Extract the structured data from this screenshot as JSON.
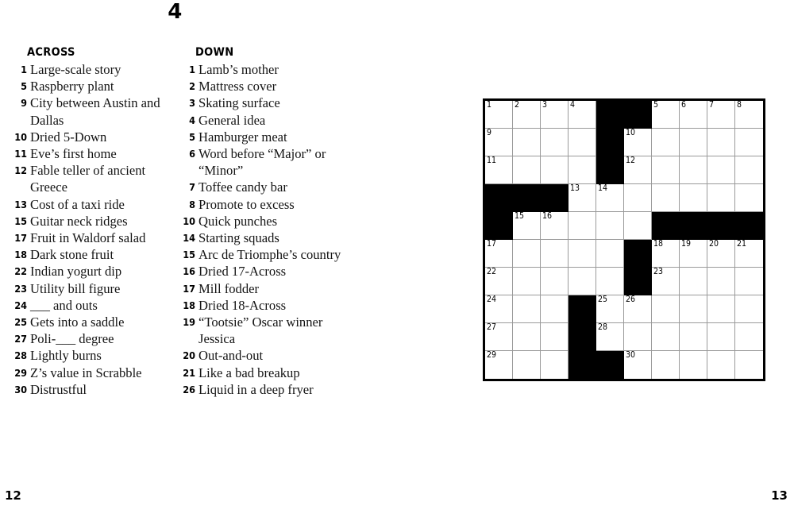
{
  "puzzle": {
    "number": "4"
  },
  "across": {
    "heading": "ACROSS",
    "clues": [
      {
        "num": "1",
        "text": "Large-scale story"
      },
      {
        "num": "5",
        "text": "Raspberry plant"
      },
      {
        "num": "9",
        "text": "City between Austin and Dallas"
      },
      {
        "num": "10",
        "text": "Dried 5-Down"
      },
      {
        "num": "11",
        "text": "Eve’s first home"
      },
      {
        "num": "12",
        "text": "Fable teller of ancient Greece"
      },
      {
        "num": "13",
        "text": "Cost of a taxi ride"
      },
      {
        "num": "15",
        "text": "Guitar neck ridges"
      },
      {
        "num": "17",
        "text": "Fruit in Waldorf salad"
      },
      {
        "num": "18",
        "text": "Dark stone fruit"
      },
      {
        "num": "22",
        "text": "Indian yogurt dip"
      },
      {
        "num": "23",
        "text": "Utility bill figure"
      },
      {
        "num": "24",
        "text": "___ and outs"
      },
      {
        "num": "25",
        "text": "Gets into a saddle"
      },
      {
        "num": "27",
        "text": "Poli-___ degree"
      },
      {
        "num": "28",
        "text": "Lightly burns"
      },
      {
        "num": "29",
        "text": "Z’s value in Scrabble"
      },
      {
        "num": "30",
        "text": "Distrustful"
      }
    ]
  },
  "down": {
    "heading": "DOWN",
    "clues": [
      {
        "num": "1",
        "text": "Lamb’s mother"
      },
      {
        "num": "2",
        "text": "Mattress cover"
      },
      {
        "num": "3",
        "text": "Skating surface"
      },
      {
        "num": "4",
        "text": "General idea"
      },
      {
        "num": "5",
        "text": "Hamburger meat"
      },
      {
        "num": "6",
        "text": "Word before “Major” or “Minor”"
      },
      {
        "num": "7",
        "text": "Toffee candy bar"
      },
      {
        "num": "8",
        "text": "Promote to excess"
      },
      {
        "num": "10",
        "text": "Quick punches"
      },
      {
        "num": "14",
        "text": "Starting squads"
      },
      {
        "num": "15",
        "text": "Arc de Triomphe’s country"
      },
      {
        "num": "16",
        "text": "Dried 17-Across"
      },
      {
        "num": "17",
        "text": "Mill fodder"
      },
      {
        "num": "18",
        "text": "Dried 18-Across"
      },
      {
        "num": "19",
        "text": "“Tootsie” Oscar winner Jessica"
      },
      {
        "num": "20",
        "text": "Out-and-out"
      },
      {
        "num": "21",
        "text": "Like a bad breakup"
      },
      {
        "num": "26",
        "text": "Liquid in a deep fryer"
      }
    ]
  },
  "grid": {
    "rows": 10,
    "cols": 10,
    "colors": {
      "block": "#000000",
      "cell": "#ffffff",
      "rule": "#9a9a9a",
      "border": "#000000"
    },
    "cells": [
      [
        {
          "block": false,
          "num": "1"
        },
        {
          "block": false,
          "num": "2"
        },
        {
          "block": false,
          "num": "3"
        },
        {
          "block": false,
          "num": "4"
        },
        {
          "block": true,
          "num": ""
        },
        {
          "block": true,
          "num": ""
        },
        {
          "block": false,
          "num": "5"
        },
        {
          "block": false,
          "num": "6"
        },
        {
          "block": false,
          "num": "7"
        },
        {
          "block": false,
          "num": "8"
        }
      ],
      [
        {
          "block": false,
          "num": "9"
        },
        {
          "block": false,
          "num": ""
        },
        {
          "block": false,
          "num": ""
        },
        {
          "block": false,
          "num": ""
        },
        {
          "block": true,
          "num": ""
        },
        {
          "block": false,
          "num": "10"
        },
        {
          "block": false,
          "num": ""
        },
        {
          "block": false,
          "num": ""
        },
        {
          "block": false,
          "num": ""
        },
        {
          "block": false,
          "num": ""
        }
      ],
      [
        {
          "block": false,
          "num": "11"
        },
        {
          "block": false,
          "num": ""
        },
        {
          "block": false,
          "num": ""
        },
        {
          "block": false,
          "num": ""
        },
        {
          "block": true,
          "num": ""
        },
        {
          "block": false,
          "num": "12"
        },
        {
          "block": false,
          "num": ""
        },
        {
          "block": false,
          "num": ""
        },
        {
          "block": false,
          "num": ""
        },
        {
          "block": false,
          "num": ""
        }
      ],
      [
        {
          "block": true,
          "num": ""
        },
        {
          "block": true,
          "num": ""
        },
        {
          "block": true,
          "num": ""
        },
        {
          "block": false,
          "num": "13"
        },
        {
          "block": false,
          "num": "14"
        },
        {
          "block": false,
          "num": ""
        },
        {
          "block": false,
          "num": ""
        },
        {
          "block": false,
          "num": ""
        },
        {
          "block": false,
          "num": ""
        },
        {
          "block": false,
          "num": ""
        }
      ],
      [
        {
          "block": true,
          "num": ""
        },
        {
          "block": false,
          "num": "15"
        },
        {
          "block": false,
          "num": "16"
        },
        {
          "block": false,
          "num": ""
        },
        {
          "block": false,
          "num": ""
        },
        {
          "block": false,
          "num": ""
        },
        {
          "block": true,
          "num": ""
        },
        {
          "block": true,
          "num": ""
        },
        {
          "block": true,
          "num": ""
        },
        {
          "block": true,
          "num": ""
        }
      ],
      [
        {
          "block": false,
          "num": "17"
        },
        {
          "block": false,
          "num": ""
        },
        {
          "block": false,
          "num": ""
        },
        {
          "block": false,
          "num": ""
        },
        {
          "block": false,
          "num": ""
        },
        {
          "block": true,
          "num": ""
        },
        {
          "block": false,
          "num": "18"
        },
        {
          "block": false,
          "num": "19"
        },
        {
          "block": false,
          "num": "20"
        },
        {
          "block": false,
          "num": "21"
        }
      ],
      [
        {
          "block": false,
          "num": "22"
        },
        {
          "block": false,
          "num": ""
        },
        {
          "block": false,
          "num": ""
        },
        {
          "block": false,
          "num": ""
        },
        {
          "block": false,
          "num": ""
        },
        {
          "block": true,
          "num": ""
        },
        {
          "block": false,
          "num": "23"
        },
        {
          "block": false,
          "num": ""
        },
        {
          "block": false,
          "num": ""
        },
        {
          "block": false,
          "num": ""
        }
      ],
      [
        {
          "block": false,
          "num": "24"
        },
        {
          "block": false,
          "num": ""
        },
        {
          "block": false,
          "num": ""
        },
        {
          "block": true,
          "num": ""
        },
        {
          "block": false,
          "num": "25"
        },
        {
          "block": false,
          "num": "26"
        },
        {
          "block": false,
          "num": ""
        },
        {
          "block": false,
          "num": ""
        },
        {
          "block": false,
          "num": ""
        },
        {
          "block": false,
          "num": ""
        }
      ],
      [
        {
          "block": false,
          "num": "27"
        },
        {
          "block": false,
          "num": ""
        },
        {
          "block": false,
          "num": ""
        },
        {
          "block": true,
          "num": ""
        },
        {
          "block": false,
          "num": "28"
        },
        {
          "block": false,
          "num": ""
        },
        {
          "block": false,
          "num": ""
        },
        {
          "block": false,
          "num": ""
        },
        {
          "block": false,
          "num": ""
        },
        {
          "block": false,
          "num": ""
        }
      ],
      [
        {
          "block": false,
          "num": "29"
        },
        {
          "block": false,
          "num": ""
        },
        {
          "block": false,
          "num": ""
        },
        {
          "block": true,
          "num": ""
        },
        {
          "block": true,
          "num": ""
        },
        {
          "block": false,
          "num": "30"
        },
        {
          "block": false,
          "num": ""
        },
        {
          "block": false,
          "num": ""
        },
        {
          "block": false,
          "num": ""
        },
        {
          "block": false,
          "num": ""
        }
      ]
    ]
  },
  "folio": {
    "left": "12",
    "right": "13"
  }
}
